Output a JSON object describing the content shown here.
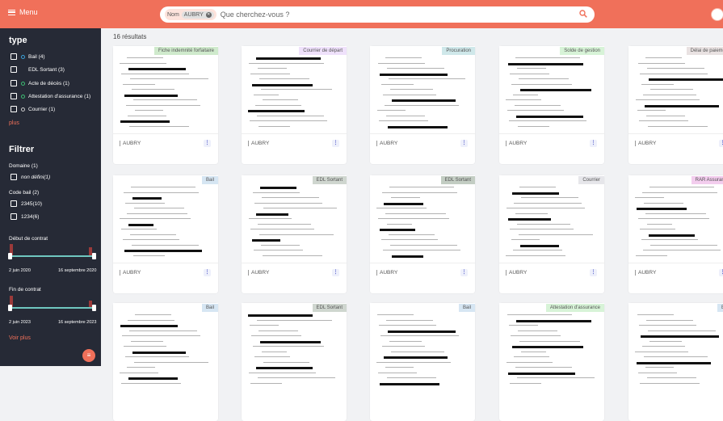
{
  "header": {
    "menu_label": "Menu",
    "search": {
      "chip_field": "Nom",
      "chip_value": "AUBRY",
      "placeholder": "Que cherchez-vous ?"
    }
  },
  "sidebar": {
    "type_title": "type",
    "type_options": [
      {
        "label": "Bail (4)"
      },
      {
        "label": "EDL Sortant (3)"
      },
      {
        "label": "Acte de décès (1)"
      },
      {
        "label": "Attestation d'assurance (1)"
      },
      {
        "label": "Courrier (1)"
      }
    ],
    "type_more": "plus",
    "filter_title": "Filtrer",
    "domaine_title": "Domaine (1)",
    "domaine_options": [
      {
        "label": "non défini(1)"
      }
    ],
    "code_bail_title": "Code bail (2)",
    "code_bail_options": [
      {
        "label": "2345(10)"
      },
      {
        "label": "1234(6)"
      }
    ],
    "debut_title": "Début de contrat",
    "debut_start": "2 juin 2020",
    "debut_end": "16 septembre 2020",
    "fin_title": "Fin de contrat",
    "fin_start": "2 juin 2023",
    "fin_end": "16 septembre 2023",
    "voir_plus": "Voir plus"
  },
  "results": {
    "count": "16 résultats",
    "cards": [
      {
        "tag": "Fiche indemnité forfaitaire",
        "owner": "AUBRY",
        "tag_bg": "#cfeacc"
      },
      {
        "tag": "Courrier de départ",
        "owner": "AUBRY",
        "tag_bg": "#efe1fb"
      },
      {
        "tag": "Procuration",
        "owner": "AUBRY",
        "tag_bg": "#cfe8ea"
      },
      {
        "tag": "Solde de gestion",
        "owner": "AUBRY",
        "tag_bg": "#d7f3d7"
      },
      {
        "tag": "Délai de paiement",
        "owner": "AUBRY",
        "tag_bg": "#e9e2e2"
      },
      {
        "tag": "Bail",
        "owner": "AUBRY",
        "tag_bg": "#d6e6f3"
      },
      {
        "tag": "EDL Sortant",
        "owner": "AUBRY",
        "tag_bg": "#cfd6cf"
      },
      {
        "tag": "EDL Sortant",
        "owner": "AUBRY",
        "tag_bg": "#c3cdc3"
      },
      {
        "tag": "Courrier",
        "owner": "AUBRY",
        "tag_bg": "#e6e6ea"
      },
      {
        "tag": "RAR Assurance",
        "owner": "AUBRY",
        "tag_bg": "#f3cdee"
      },
      {
        "tag": "Bail",
        "owner": "",
        "tag_bg": "#d6e6f3"
      },
      {
        "tag": "EDL Sortant",
        "owner": "",
        "tag_bg": "#cfd6cf"
      },
      {
        "tag": "Bail",
        "owner": "",
        "tag_bg": "#d6e6f3"
      },
      {
        "tag": "Attestation d'assurance",
        "owner": "",
        "tag_bg": "#d7f3d7"
      },
      {
        "tag": "Bail",
        "owner": "",
        "tag_bg": "#d6e6f3"
      }
    ]
  },
  "colors": {
    "accent": "#f0705a",
    "sidebar": "#262a36",
    "range": "#6fc7c0"
  }
}
